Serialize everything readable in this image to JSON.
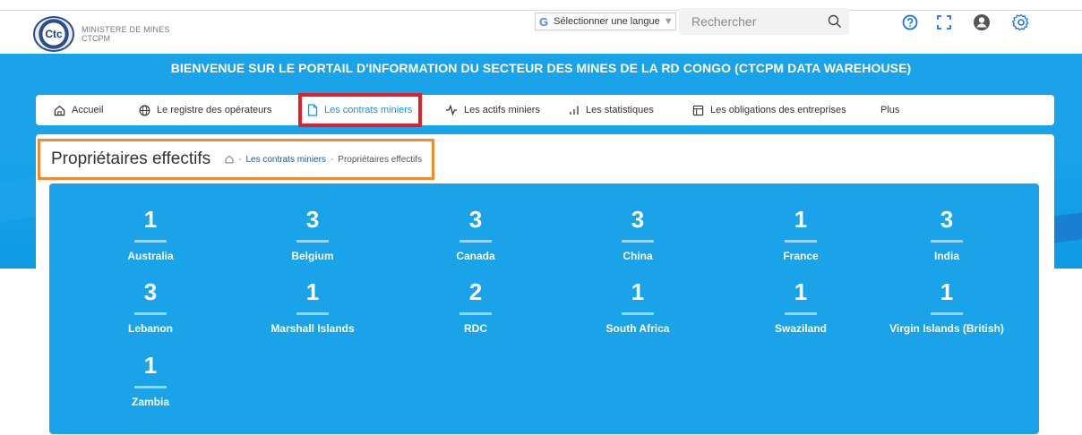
{
  "header": {
    "org_line1": "MINISTERE DE MINES",
    "org_line2": "CTCPM",
    "logo_text": "Ctc",
    "language_label": "Sélectionner une langue",
    "language_caret": "▼",
    "search_placeholder": "Rechercher"
  },
  "banner": "BIENVENUE SUR LE PORTAIL D'INFORMATION DU SECTEUR DES MINES DE LA RD CONGO (CTCPM DATA WAREHOUSE)",
  "nav": {
    "items": [
      {
        "label": "Accueil",
        "icon": "home-icon"
      },
      {
        "label": "Le registre des opérateurs",
        "icon": "globe-icon"
      },
      {
        "label": "Les contrats miniers",
        "icon": "file-icon",
        "active": true
      },
      {
        "label": "Les actifs miniers",
        "icon": "activity-icon"
      },
      {
        "label": "Les statistiques",
        "icon": "bar-chart-icon"
      },
      {
        "label": "Les obligations des entreprises",
        "icon": "layout-icon"
      },
      {
        "label": "Plus",
        "icon": ""
      }
    ]
  },
  "page": {
    "title": "Propriétaires effectifs",
    "breadcrumb": [
      "Les contrats miniers",
      "Propriétaires effectifs"
    ],
    "breadcrumb_sep": "-"
  },
  "stats": [
    {
      "value": "1",
      "country": "Australia"
    },
    {
      "value": "3",
      "country": "Belgium"
    },
    {
      "value": "3",
      "country": "Canada"
    },
    {
      "value": "3",
      "country": "China"
    },
    {
      "value": "1",
      "country": "France"
    },
    {
      "value": "3",
      "country": "India"
    },
    {
      "value": "3",
      "country": "Lebanon"
    },
    {
      "value": "1",
      "country": "Marshall Islands"
    },
    {
      "value": "2",
      "country": "RDC"
    },
    {
      "value": "1",
      "country": "South Africa"
    },
    {
      "value": "1",
      "country": "Swaziland"
    },
    {
      "value": "1",
      "country": "Virgin Islands (British)"
    },
    {
      "value": "1",
      "country": "Zambia"
    }
  ],
  "colors": {
    "primary": "#1aa3e8",
    "active_nav": "#1a8fe3",
    "highlight_red": "#e0202a",
    "highlight_orange": "#f08a2e",
    "icon_blue": "#1a73e8"
  }
}
